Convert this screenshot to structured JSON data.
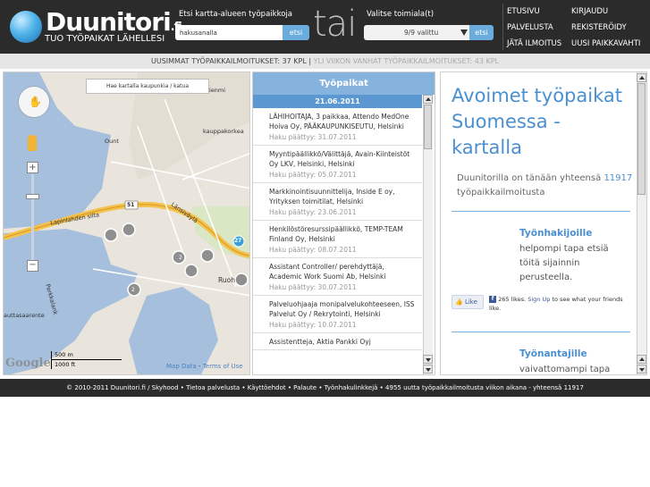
{
  "header": {
    "logo_name": "Duunitori",
    "logo_tld": ".fi",
    "slogan": "TUO TYÖPAIKAT LÄHELLESI",
    "search_label": "Etsi kartta-alueen työpaikkoja",
    "search_value": "hakusanalla",
    "search_button": "etsi",
    "or_text": "tai",
    "field_label": "Valitse toimiala(t)",
    "field_value": "9/9 valittu",
    "field_button": "etsi",
    "nav": [
      "ETUSIVU",
      "KIRJAUDU",
      "PALVELUSTA",
      "REKISTERÖIDY",
      "JÄTÄ ILMOITUS",
      "UUSI PAIKKAVAHTI"
    ]
  },
  "ticker": {
    "new_text": "UUSIMMAT TYÖPAIKKAILMOITUKSET: 37 KPL",
    "separator": "|",
    "old_text": "YLI VIIKON VANHAT TYÖPAIKKAILMOITUKSET: 43 KPL"
  },
  "map": {
    "search_hint": "Hae kartalla kaupunkia / katua",
    "labels": [
      "Lapinlahden silta",
      "Länsiväylä",
      "kauppakorkea",
      "Ruoh",
      "ienmi",
      "Ount",
      "Porkkalank",
      "auttasaarente"
    ],
    "road_number": "51",
    "road_number_2": "27",
    "marker_counts": [
      "2",
      "2"
    ],
    "google": "Google",
    "scale_m": "500 m",
    "scale_ft": "1000 ft",
    "link_map_data": "Map Data",
    "link_sep": "-",
    "link_terms": "Terms of Use",
    "zoom_in": "+",
    "zoom_out": "−",
    "colors": {
      "water": "#a5bfdd",
      "land": "#e9e5dc",
      "road": "#f4c24d",
      "marker": "#8f8f8f"
    }
  },
  "jobs": {
    "title": "Työpaikat",
    "date": "21.06.2011",
    "items": [
      {
        "title": "LÄHIHOITAJA, 3 paikkaa, Attendo MedOne Hoiva Oy, PÄÄKAUPUNKISEUTU, Helsinki",
        "deadline": "Haku päättyy: 31.07.2011"
      },
      {
        "title": "Myyntipäällikkö/Välittäjä, Avain-Kiinteistöt Oy LKV, Helsinki, Helsinki",
        "deadline": "Haku päättyy: 05.07.2011"
      },
      {
        "title": "Markkinointisuunnittelija, Inside E oy, Yrityksen toimitilat, Helsinki",
        "deadline": "Haku päättyy: 23.06.2011"
      },
      {
        "title": "Henkilöstöresurssipäällikkö, TEMP-TEAM Finland Oy, Helsinki",
        "deadline": "Haku päättyy: 08.07.2011"
      },
      {
        "title": "Assistant Controller/ perehdyttäjä, Academic Work Suomi Ab, Helsinki",
        "deadline": "Haku päättyy: 30.07.2011"
      },
      {
        "title": "Palveluohjaaja monipalvelukohteeseen, ISS Palvelut Oy / Rekrytointi, Helsinki",
        "deadline": "Haku päättyy: 10.07.2011"
      },
      {
        "title": "Assistentteja, Aktia Pankki Oyj",
        "deadline": ""
      }
    ]
  },
  "info": {
    "heading": "Avoimet työpaikat Suomessa - kartalla",
    "lead_before": "Duunitorilla on tänään yhteensä",
    "lead_count": "11917",
    "lead_after": "työpaikkailmoitusta",
    "seekers_title": "Työnhakijoille",
    "seekers_body": "helpompi tapa etsiä töitä sijainnin perusteella.",
    "like_button": "Like",
    "like_text_count": "265 likes.",
    "like_signup": "Sign Up",
    "like_text_rest": "to see what your friends like.",
    "employers_title": "Työnantajille",
    "employers_body": "vaivattomampi tapa"
  },
  "footer": {
    "text": "© 2010-2011 Duunitori.fi / Skyhood • Tietoa palvelusta • Käyttöehdot • Palaute • Työnhakulinkkejä • 4955 uutta työpaikkailmoitusta viikon aikana - yhteensä 11917"
  }
}
